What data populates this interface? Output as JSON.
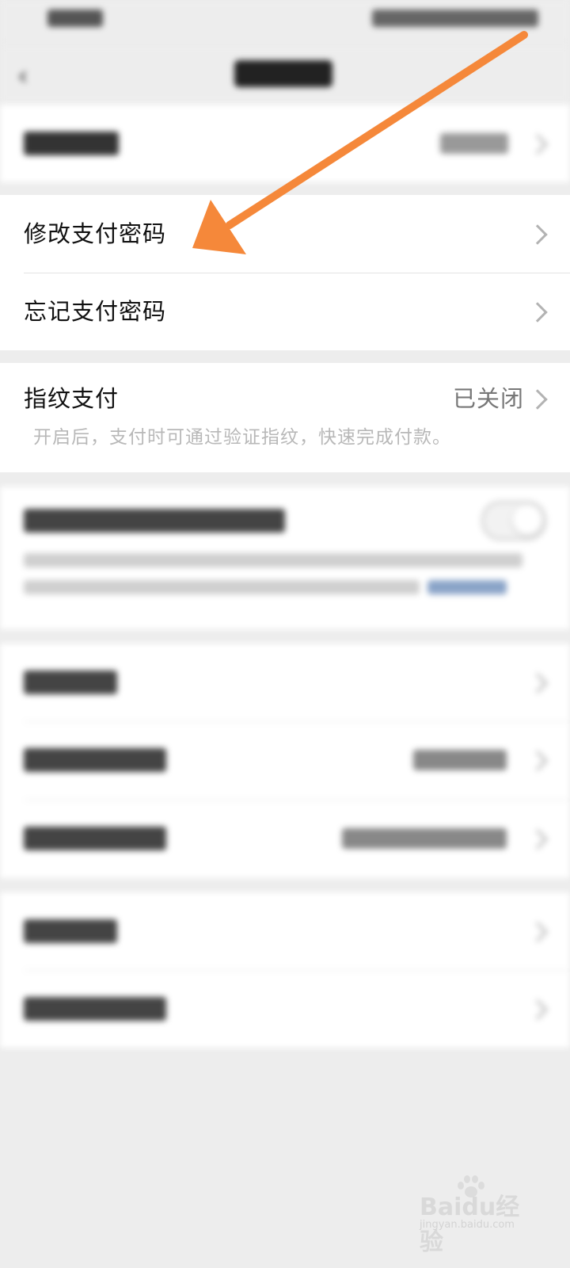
{
  "rows": {
    "change_password": {
      "label": "修改支付密码"
    },
    "forgot_password": {
      "label": "忘记支付密码"
    },
    "fingerprint": {
      "label": "指纹支付",
      "value": "已关闭",
      "hint": "开启后，支付时可通过验证指纹，快速完成付款。"
    }
  },
  "watermark": {
    "brand": "Baidu经验",
    "url": "jingyan.baidu.com"
  },
  "colors": {
    "background": "#ededed",
    "card": "#ffffff",
    "arrow": "#f5883a",
    "chevron": "#b3b3b3"
  },
  "icons": [
    "back-arrow-icon",
    "chevron-right-icon",
    "toggle-switch",
    "annotation-arrow",
    "baidu-paw-icon"
  ]
}
